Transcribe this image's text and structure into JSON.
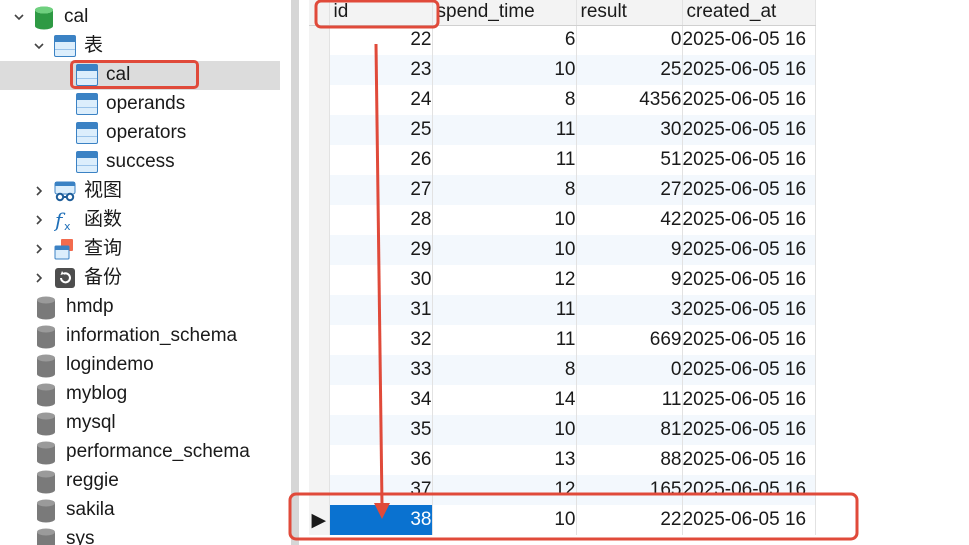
{
  "tree": {
    "database_cal": "cal",
    "tables_folder": "表",
    "tables": [
      "cal",
      "operands",
      "operators",
      "success"
    ],
    "views_folder": "视图",
    "functions_folder": "函数",
    "queries_folder": "查询",
    "backups_folder": "备份",
    "other_databases": [
      "hmdp",
      "information_schema",
      "logindemo",
      "myblog",
      "mysql",
      "performance_schema",
      "reggie",
      "sakila",
      "sys"
    ]
  },
  "grid": {
    "columns": [
      "id",
      "spend_time",
      "result",
      "created_at"
    ],
    "rows": [
      {
        "id": "22",
        "spend_time": "6",
        "result": "0",
        "created_at": "2025-06-05 16"
      },
      {
        "id": "23",
        "spend_time": "10",
        "result": "25",
        "created_at": "2025-06-05 16"
      },
      {
        "id": "24",
        "spend_time": "8",
        "result": "4356",
        "created_at": "2025-06-05 16"
      },
      {
        "id": "25",
        "spend_time": "11",
        "result": "30",
        "created_at": "2025-06-05 16"
      },
      {
        "id": "26",
        "spend_time": "11",
        "result": "51",
        "created_at": "2025-06-05 16"
      },
      {
        "id": "27",
        "spend_time": "8",
        "result": "27",
        "created_at": "2025-06-05 16"
      },
      {
        "id": "28",
        "spend_time": "10",
        "result": "42",
        "created_at": "2025-06-05 16"
      },
      {
        "id": "29",
        "spend_time": "10",
        "result": "9",
        "created_at": "2025-06-05 16"
      },
      {
        "id": "30",
        "spend_time": "12",
        "result": "9",
        "created_at": "2025-06-05 16"
      },
      {
        "id": "31",
        "spend_time": "11",
        "result": "3",
        "created_at": "2025-06-05 16"
      },
      {
        "id": "32",
        "spend_time": "11",
        "result": "669",
        "created_at": "2025-06-05 16"
      },
      {
        "id": "33",
        "spend_time": "8",
        "result": "0",
        "created_at": "2025-06-05 16"
      },
      {
        "id": "34",
        "spend_time": "14",
        "result": "11",
        "created_at": "2025-06-05 16"
      },
      {
        "id": "35",
        "spend_time": "10",
        "result": "81",
        "created_at": "2025-06-05 16"
      },
      {
        "id": "36",
        "spend_time": "13",
        "result": "88",
        "created_at": "2025-06-05 16"
      },
      {
        "id": "37",
        "spend_time": "12",
        "result": "165",
        "created_at": "2025-06-05 16"
      },
      {
        "id": "38",
        "spend_time": "10",
        "result": "22",
        "created_at": "2025-06-05 16"
      }
    ],
    "current_row_marker": "▶"
  },
  "colors": {
    "annotation_red": "#e04a3a",
    "selection_blue": "#0a72d0",
    "db_green": "#2e9a44",
    "table_blue": "#3b82c4"
  }
}
